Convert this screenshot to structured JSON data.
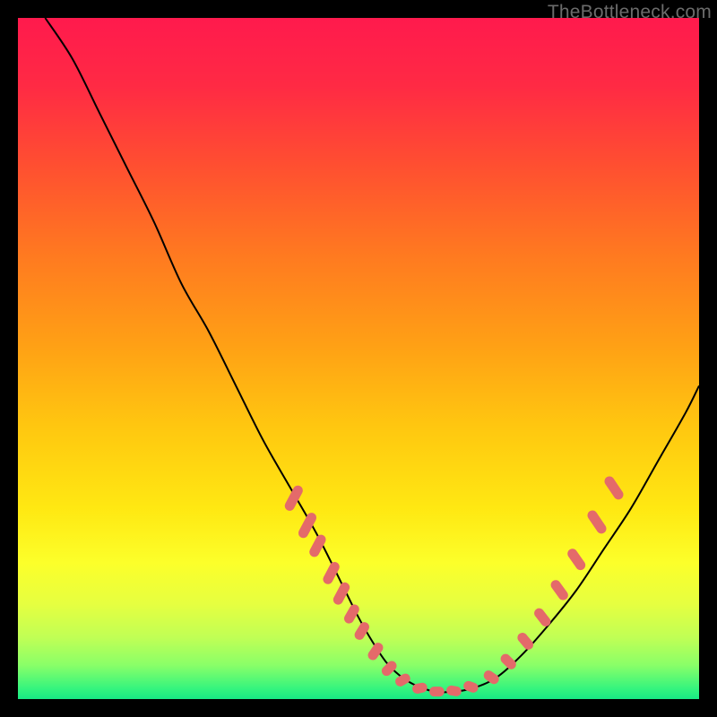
{
  "watermark": "TheBottleneck.com",
  "chart_data": {
    "type": "line",
    "title": "",
    "xlabel": "",
    "ylabel": "",
    "xlim": [
      0,
      100
    ],
    "ylim": [
      0,
      100
    ],
    "series": [
      {
        "name": "curve",
        "x": [
          4,
          8,
          12,
          16,
          20,
          24,
          28,
          32,
          36,
          40,
          44,
          48,
          50,
          52,
          54,
          56,
          58,
          60,
          62,
          66,
          70,
          74,
          78,
          82,
          86,
          90,
          94,
          98,
          100
        ],
        "y": [
          100,
          94,
          86,
          78,
          70,
          61,
          54,
          46,
          38,
          31,
          24,
          16,
          12,
          8.5,
          5.5,
          3.5,
          2.2,
          1.4,
          1.0,
          1.4,
          3.0,
          6.5,
          11,
          16,
          22,
          28,
          35,
          42,
          46
        ]
      }
    ],
    "markers": [
      {
        "x": 40.5,
        "y": 29.5,
        "len": 4,
        "angle": -62
      },
      {
        "x": 42.5,
        "y": 25.5,
        "len": 4,
        "angle": -62
      },
      {
        "x": 44.0,
        "y": 22.5,
        "len": 3.5,
        "angle": -62
      },
      {
        "x": 46.0,
        "y": 18.5,
        "len": 3.5,
        "angle": -62
      },
      {
        "x": 47.5,
        "y": 15.5,
        "len": 3.5,
        "angle": -62
      },
      {
        "x": 49.0,
        "y": 12.5,
        "len": 3.0,
        "angle": -60
      },
      {
        "x": 50.5,
        "y": 10.0,
        "len": 2.8,
        "angle": -58
      },
      {
        "x": 52.5,
        "y": 7.0,
        "len": 2.8,
        "angle": -55
      },
      {
        "x": 54.5,
        "y": 4.5,
        "len": 2.5,
        "angle": -45
      },
      {
        "x": 56.5,
        "y": 2.8,
        "len": 2.3,
        "angle": -30
      },
      {
        "x": 59.0,
        "y": 1.6,
        "len": 2.2,
        "angle": -12
      },
      {
        "x": 61.5,
        "y": 1.1,
        "len": 2.2,
        "angle": 0
      },
      {
        "x": 64.0,
        "y": 1.2,
        "len": 2.2,
        "angle": 10
      },
      {
        "x": 66.5,
        "y": 1.8,
        "len": 2.2,
        "angle": 20
      },
      {
        "x": 69.5,
        "y": 3.2,
        "len": 2.4,
        "angle": 35
      },
      {
        "x": 72.0,
        "y": 5.5,
        "len": 2.6,
        "angle": 45
      },
      {
        "x": 74.5,
        "y": 8.5,
        "len": 2.8,
        "angle": 50
      },
      {
        "x": 77.0,
        "y": 12.0,
        "len": 3.0,
        "angle": 52
      },
      {
        "x": 79.5,
        "y": 16.0,
        "len": 3.3,
        "angle": 54
      },
      {
        "x": 82.0,
        "y": 20.5,
        "len": 3.5,
        "angle": 55
      },
      {
        "x": 85.0,
        "y": 26.0,
        "len": 3.8,
        "angle": 56
      },
      {
        "x": 87.5,
        "y": 31.0,
        "len": 3.8,
        "angle": 56
      }
    ],
    "gradient_stops": [
      {
        "pos": 0.0,
        "color": "#ff1a4d"
      },
      {
        "pos": 0.1,
        "color": "#ff2a44"
      },
      {
        "pos": 0.22,
        "color": "#ff5030"
      },
      {
        "pos": 0.35,
        "color": "#ff7a20"
      },
      {
        "pos": 0.48,
        "color": "#ffa015"
      },
      {
        "pos": 0.6,
        "color": "#ffc710"
      },
      {
        "pos": 0.72,
        "color": "#ffe812"
      },
      {
        "pos": 0.8,
        "color": "#fcff2a"
      },
      {
        "pos": 0.86,
        "color": "#e6ff40"
      },
      {
        "pos": 0.91,
        "color": "#c0ff55"
      },
      {
        "pos": 0.95,
        "color": "#8aff68"
      },
      {
        "pos": 0.985,
        "color": "#34f47e"
      },
      {
        "pos": 1.0,
        "color": "#18e884"
      }
    ],
    "marker_color": "#e46a6a",
    "curve_color": "#000000"
  }
}
